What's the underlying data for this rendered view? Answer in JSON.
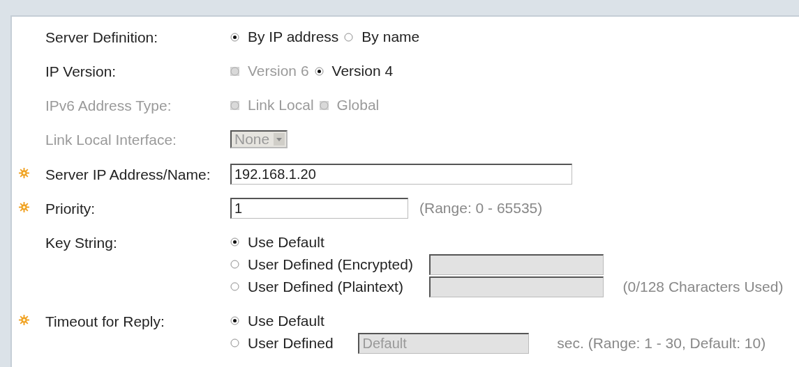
{
  "fields": [
    {
      "kind": "radio",
      "label": "Server Definition:",
      "required": false,
      "disabled": false,
      "options": [
        {
          "label": "By IP address",
          "selected": true,
          "disabled": false
        },
        {
          "label": "By name",
          "selected": false,
          "disabled": false
        }
      ]
    },
    {
      "kind": "radio",
      "label": "IP Version:",
      "required": false,
      "disabled": false,
      "options": [
        {
          "label": "Version 6",
          "selected": false,
          "disabled": true
        },
        {
          "label": "Version 4",
          "selected": true,
          "disabled": false
        }
      ]
    },
    {
      "kind": "radio",
      "label": "IPv6 Address Type:",
      "required": false,
      "disabled": true,
      "options": [
        {
          "label": "Link Local",
          "selected": false,
          "disabled": true
        },
        {
          "label": "Global",
          "selected": false,
          "disabled": true
        }
      ]
    },
    {
      "kind": "select",
      "label": "Link Local Interface:",
      "required": false,
      "disabled": true,
      "value": "None"
    },
    {
      "kind": "text",
      "label": "Server IP Address/Name:",
      "required": true,
      "disabled": false,
      "value": "192.168.1.20"
    },
    {
      "kind": "text",
      "label": "Priority:",
      "required": true,
      "disabled": false,
      "value": "1",
      "note": "(Range: 0 - 65535)"
    },
    {
      "kind": "radio_stack",
      "label": "Key String:",
      "required": false,
      "disabled": false,
      "options": [
        {
          "label": "Use Default",
          "selected": true,
          "disabled": false
        },
        {
          "label": "User Defined (Encrypted)",
          "selected": false,
          "disabled": false,
          "input": {
            "disabled": true
          }
        },
        {
          "label": "User Defined (Plaintext)",
          "selected": false,
          "disabled": false,
          "input": {
            "disabled": true
          },
          "note": "(0/128 Characters Used)"
        }
      ]
    },
    {
      "kind": "radio_stack",
      "label": "Timeout for Reply:",
      "required": true,
      "disabled": false,
      "options": [
        {
          "label": "Use Default",
          "selected": true,
          "disabled": false
        },
        {
          "label": "User Defined",
          "selected": false,
          "disabled": false,
          "input": {
            "placeholder": "Default",
            "disabled": true
          },
          "note": "sec. (Range: 1 - 30, Default: 10)"
        }
      ]
    }
  ]
}
